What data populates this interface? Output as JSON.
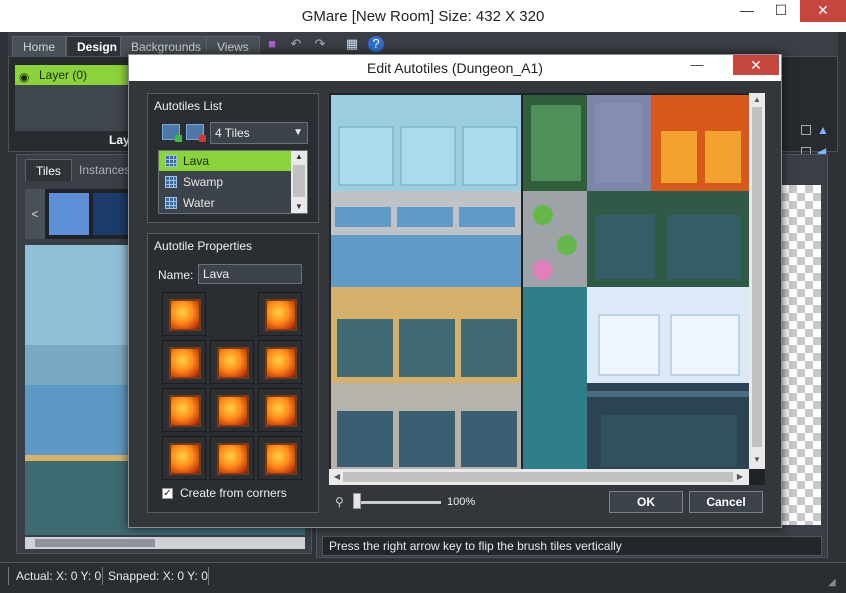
{
  "window": {
    "title": "GMare [New Room] Size: 432 X 320",
    "minimize": "—",
    "maximize": "☐",
    "close": "✕"
  },
  "ribbon": {
    "tabs": [
      "Home",
      "Design",
      "Backgrounds",
      "Views"
    ],
    "layer_item": "Layer (0)",
    "layers_caption": "Laye"
  },
  "left_pane": {
    "tabs": [
      "Tiles",
      "Instances"
    ],
    "strip_arrow": "<"
  },
  "hint": "Press the right arrow key to flip the brush tiles vertically",
  "status": {
    "actual": "Actual: X: 0 Y: 0",
    "snapped": "Snapped: X: 0 Y: 0"
  },
  "dialog": {
    "title": "Edit Autotiles (Dungeon_A1)",
    "list_group": "Autotiles List",
    "tiles_select": "4 Tiles",
    "autotiles": [
      "Lava",
      "Swamp",
      "Water"
    ],
    "selected_index": 0,
    "props_group": "Autotile Properties",
    "name_label": "Name:",
    "name_value": "Lava",
    "create_from_corners_label": "Create from corners",
    "create_from_corners_checked": true,
    "zoom_value": "100%",
    "ok_label": "OK",
    "cancel_label": "Cancel"
  },
  "colors": {
    "accent_green": "#8bd33a",
    "close_red": "#c7463d"
  }
}
